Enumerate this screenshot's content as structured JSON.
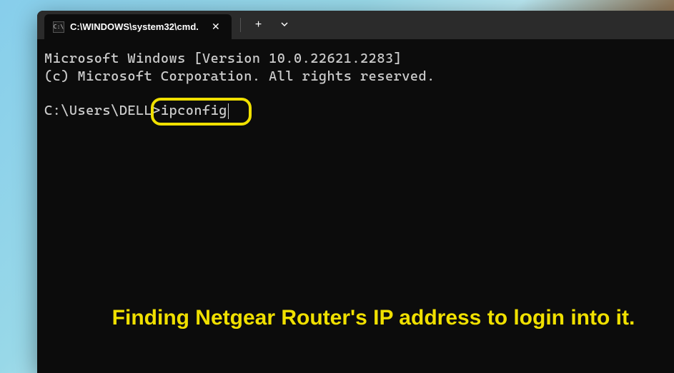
{
  "tab": {
    "title": "C:\\WINDOWS\\system32\\cmd."
  },
  "terminal": {
    "line1": "Microsoft Windows [Version 10.0.22621.2283]",
    "line2": "(c) Microsoft Corporation. All rights reserved.",
    "prompt": "C:\\Users\\DELL>",
    "command": "ipconfig"
  },
  "annotation": {
    "text": "Finding Netgear Router's IP address to login into it."
  }
}
